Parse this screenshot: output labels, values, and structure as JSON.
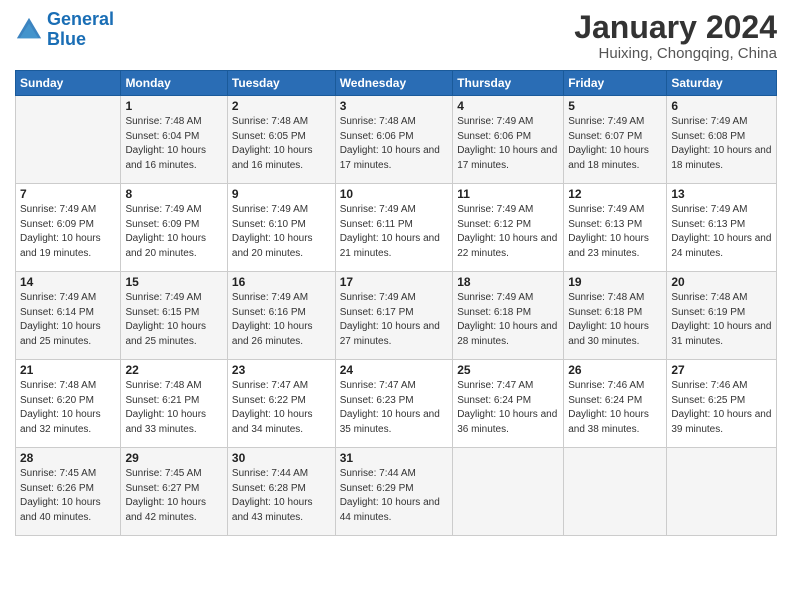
{
  "logo": {
    "line1": "General",
    "line2": "Blue"
  },
  "title": "January 2024",
  "subtitle": "Huixing, Chongqing, China",
  "days_of_week": [
    "Sunday",
    "Monday",
    "Tuesday",
    "Wednesday",
    "Thursday",
    "Friday",
    "Saturday"
  ],
  "weeks": [
    [
      {
        "num": "",
        "sunrise": "",
        "sunset": "",
        "daylight": ""
      },
      {
        "num": "1",
        "sunrise": "Sunrise: 7:48 AM",
        "sunset": "Sunset: 6:04 PM",
        "daylight": "Daylight: 10 hours and 16 minutes."
      },
      {
        "num": "2",
        "sunrise": "Sunrise: 7:48 AM",
        "sunset": "Sunset: 6:05 PM",
        "daylight": "Daylight: 10 hours and 16 minutes."
      },
      {
        "num": "3",
        "sunrise": "Sunrise: 7:48 AM",
        "sunset": "Sunset: 6:06 PM",
        "daylight": "Daylight: 10 hours and 17 minutes."
      },
      {
        "num": "4",
        "sunrise": "Sunrise: 7:49 AM",
        "sunset": "Sunset: 6:06 PM",
        "daylight": "Daylight: 10 hours and 17 minutes."
      },
      {
        "num": "5",
        "sunrise": "Sunrise: 7:49 AM",
        "sunset": "Sunset: 6:07 PM",
        "daylight": "Daylight: 10 hours and 18 minutes."
      },
      {
        "num": "6",
        "sunrise": "Sunrise: 7:49 AM",
        "sunset": "Sunset: 6:08 PM",
        "daylight": "Daylight: 10 hours and 18 minutes."
      }
    ],
    [
      {
        "num": "7",
        "sunrise": "Sunrise: 7:49 AM",
        "sunset": "Sunset: 6:09 PM",
        "daylight": "Daylight: 10 hours and 19 minutes."
      },
      {
        "num": "8",
        "sunrise": "Sunrise: 7:49 AM",
        "sunset": "Sunset: 6:09 PM",
        "daylight": "Daylight: 10 hours and 20 minutes."
      },
      {
        "num": "9",
        "sunrise": "Sunrise: 7:49 AM",
        "sunset": "Sunset: 6:10 PM",
        "daylight": "Daylight: 10 hours and 20 minutes."
      },
      {
        "num": "10",
        "sunrise": "Sunrise: 7:49 AM",
        "sunset": "Sunset: 6:11 PM",
        "daylight": "Daylight: 10 hours and 21 minutes."
      },
      {
        "num": "11",
        "sunrise": "Sunrise: 7:49 AM",
        "sunset": "Sunset: 6:12 PM",
        "daylight": "Daylight: 10 hours and 22 minutes."
      },
      {
        "num": "12",
        "sunrise": "Sunrise: 7:49 AM",
        "sunset": "Sunset: 6:13 PM",
        "daylight": "Daylight: 10 hours and 23 minutes."
      },
      {
        "num": "13",
        "sunrise": "Sunrise: 7:49 AM",
        "sunset": "Sunset: 6:13 PM",
        "daylight": "Daylight: 10 hours and 24 minutes."
      }
    ],
    [
      {
        "num": "14",
        "sunrise": "Sunrise: 7:49 AM",
        "sunset": "Sunset: 6:14 PM",
        "daylight": "Daylight: 10 hours and 25 minutes."
      },
      {
        "num": "15",
        "sunrise": "Sunrise: 7:49 AM",
        "sunset": "Sunset: 6:15 PM",
        "daylight": "Daylight: 10 hours and 25 minutes."
      },
      {
        "num": "16",
        "sunrise": "Sunrise: 7:49 AM",
        "sunset": "Sunset: 6:16 PM",
        "daylight": "Daylight: 10 hours and 26 minutes."
      },
      {
        "num": "17",
        "sunrise": "Sunrise: 7:49 AM",
        "sunset": "Sunset: 6:17 PM",
        "daylight": "Daylight: 10 hours and 27 minutes."
      },
      {
        "num": "18",
        "sunrise": "Sunrise: 7:49 AM",
        "sunset": "Sunset: 6:18 PM",
        "daylight": "Daylight: 10 hours and 28 minutes."
      },
      {
        "num": "19",
        "sunrise": "Sunrise: 7:48 AM",
        "sunset": "Sunset: 6:18 PM",
        "daylight": "Daylight: 10 hours and 30 minutes."
      },
      {
        "num": "20",
        "sunrise": "Sunrise: 7:48 AM",
        "sunset": "Sunset: 6:19 PM",
        "daylight": "Daylight: 10 hours and 31 minutes."
      }
    ],
    [
      {
        "num": "21",
        "sunrise": "Sunrise: 7:48 AM",
        "sunset": "Sunset: 6:20 PM",
        "daylight": "Daylight: 10 hours and 32 minutes."
      },
      {
        "num": "22",
        "sunrise": "Sunrise: 7:48 AM",
        "sunset": "Sunset: 6:21 PM",
        "daylight": "Daylight: 10 hours and 33 minutes."
      },
      {
        "num": "23",
        "sunrise": "Sunrise: 7:47 AM",
        "sunset": "Sunset: 6:22 PM",
        "daylight": "Daylight: 10 hours and 34 minutes."
      },
      {
        "num": "24",
        "sunrise": "Sunrise: 7:47 AM",
        "sunset": "Sunset: 6:23 PM",
        "daylight": "Daylight: 10 hours and 35 minutes."
      },
      {
        "num": "25",
        "sunrise": "Sunrise: 7:47 AM",
        "sunset": "Sunset: 6:24 PM",
        "daylight": "Daylight: 10 hours and 36 minutes."
      },
      {
        "num": "26",
        "sunrise": "Sunrise: 7:46 AM",
        "sunset": "Sunset: 6:24 PM",
        "daylight": "Daylight: 10 hours and 38 minutes."
      },
      {
        "num": "27",
        "sunrise": "Sunrise: 7:46 AM",
        "sunset": "Sunset: 6:25 PM",
        "daylight": "Daylight: 10 hours and 39 minutes."
      }
    ],
    [
      {
        "num": "28",
        "sunrise": "Sunrise: 7:45 AM",
        "sunset": "Sunset: 6:26 PM",
        "daylight": "Daylight: 10 hours and 40 minutes."
      },
      {
        "num": "29",
        "sunrise": "Sunrise: 7:45 AM",
        "sunset": "Sunset: 6:27 PM",
        "daylight": "Daylight: 10 hours and 42 minutes."
      },
      {
        "num": "30",
        "sunrise": "Sunrise: 7:44 AM",
        "sunset": "Sunset: 6:28 PM",
        "daylight": "Daylight: 10 hours and 43 minutes."
      },
      {
        "num": "31",
        "sunrise": "Sunrise: 7:44 AM",
        "sunset": "Sunset: 6:29 PM",
        "daylight": "Daylight: 10 hours and 44 minutes."
      },
      {
        "num": "",
        "sunrise": "",
        "sunset": "",
        "daylight": ""
      },
      {
        "num": "",
        "sunrise": "",
        "sunset": "",
        "daylight": ""
      },
      {
        "num": "",
        "sunrise": "",
        "sunset": "",
        "daylight": ""
      }
    ]
  ]
}
